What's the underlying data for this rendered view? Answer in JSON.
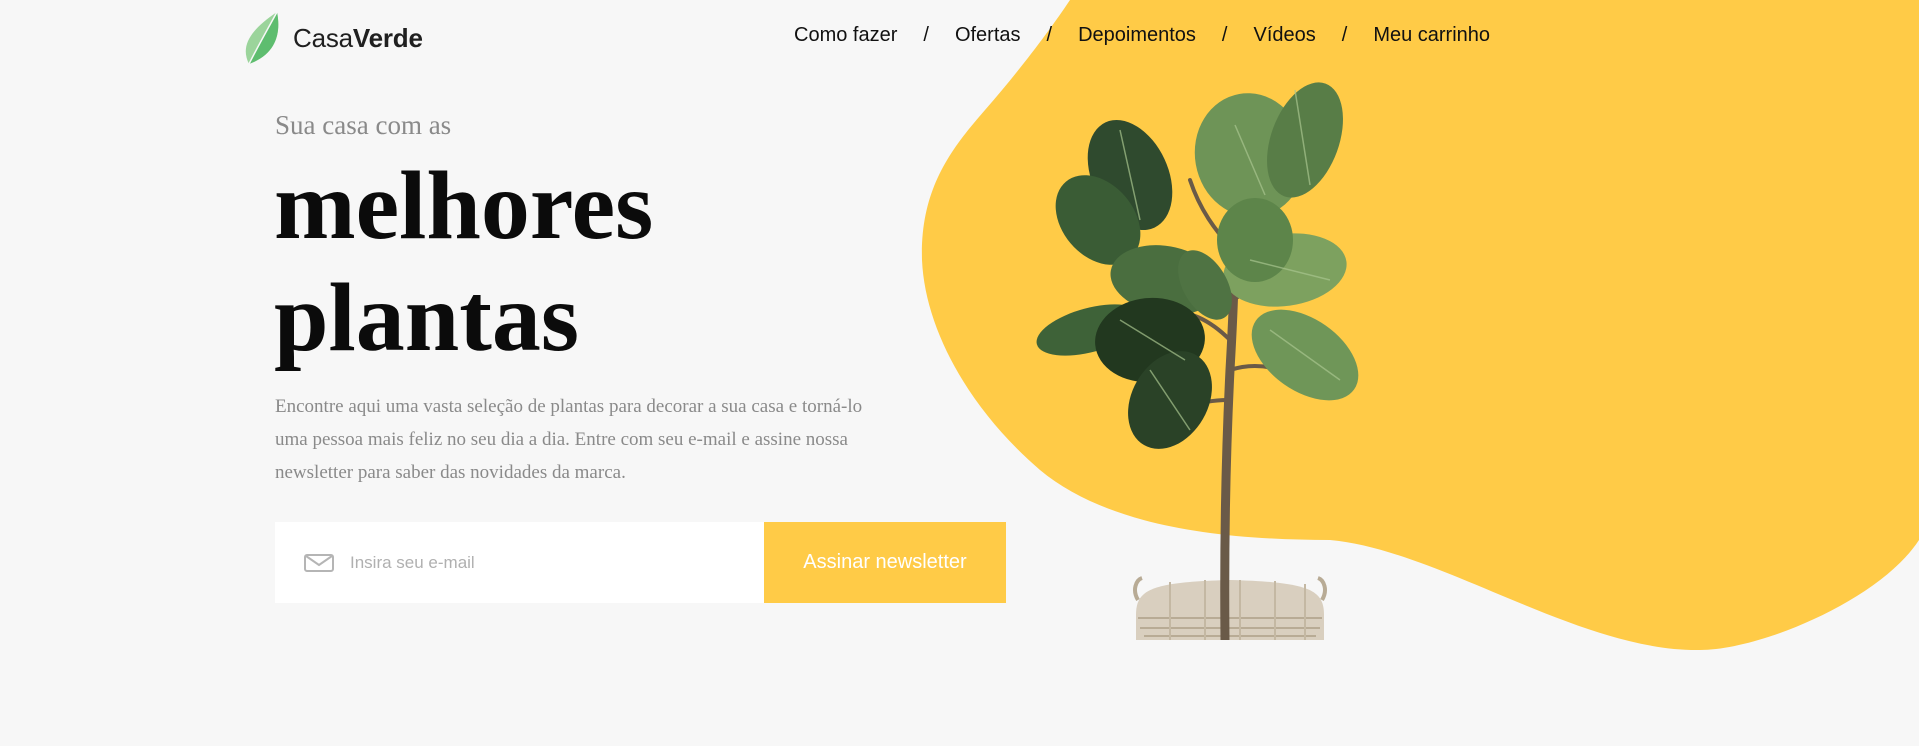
{
  "header": {
    "logo": {
      "name_part1": "Casa",
      "name_part2": "Verde",
      "icon": "leaf-icon"
    },
    "nav": [
      {
        "label": "Como fazer"
      },
      {
        "label": "Ofertas"
      },
      {
        "label": "Depoimentos"
      },
      {
        "label": "Vídeos"
      },
      {
        "label": "Meu carrinho"
      }
    ],
    "separator": "/"
  },
  "hero": {
    "kicker": "Sua casa com as",
    "headline_line1": "melhores",
    "headline_line2": "plantas",
    "description": "Encontre aqui uma vasta seleção de plantas para decorar a sua casa e torná-lo uma pessoa mais feliz no seu dia a dia. Entre com seu e-mail e assine nossa newsletter para saber das novidades da marca."
  },
  "newsletter": {
    "email_placeholder": "Insira seu e-mail",
    "email_value": "",
    "mail_icon": "mail-icon",
    "button_label": "Assinar newsletter"
  },
  "illustration": {
    "subject": "fiddle-leaf-fig-plant-icon"
  },
  "colors": {
    "accent_yellow": "#ffcb47",
    "background": "#f7f7f7",
    "logo_green_light": "#9bd49b",
    "logo_green_dark": "#5ebd6f",
    "text_dark": "#0b0b0b",
    "text_muted": "#8a8a8a"
  }
}
